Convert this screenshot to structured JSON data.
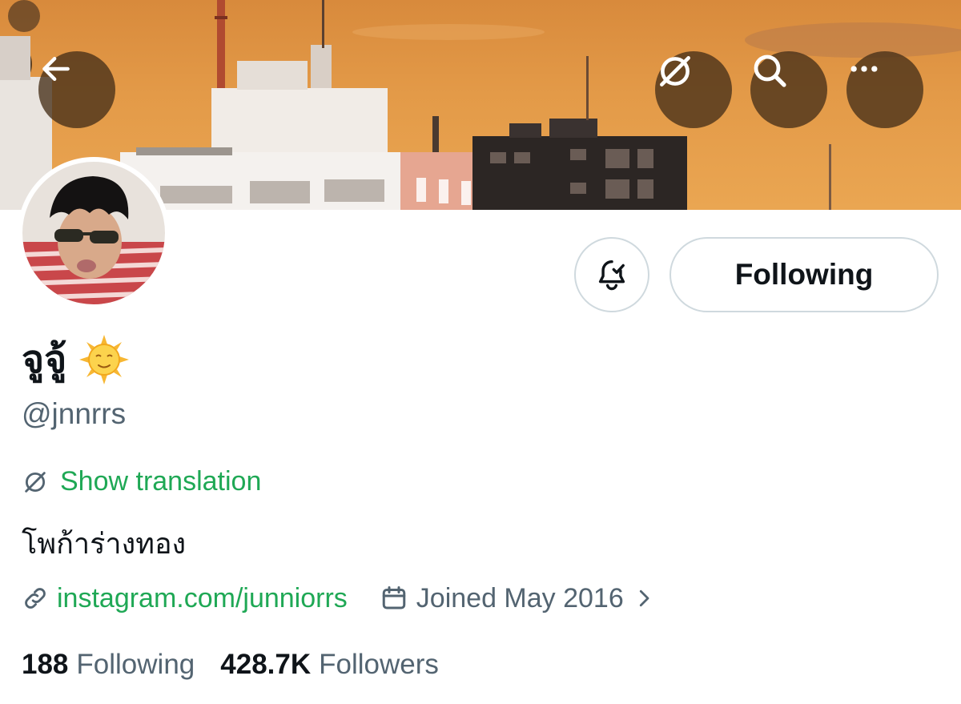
{
  "header": {
    "back_icon": "arrow-left-icon",
    "translate_icon": "translate-icon",
    "search_icon": "search-icon",
    "more_icon": "more-horizontal-icon"
  },
  "profile": {
    "display_name": "จูจู้",
    "name_emoji": "🌞",
    "handle": "@jnnrrs",
    "show_translation": "Show translation",
    "bio": "โพก้าร่างทอง",
    "website": "instagram.com/junniorrs",
    "joined": "Joined May 2016",
    "following_count": "188",
    "following_label": "Following",
    "followers_count": "428.7K",
    "followers_label": "Followers"
  },
  "actions": {
    "follow_state_label": "Following",
    "notify_icon": "bell-check-icon"
  },
  "colors": {
    "accent": "#1fa855",
    "text": "#0f1419",
    "muted": "#536471",
    "border": "#cfd9de",
    "overlay_button": "#463018"
  }
}
